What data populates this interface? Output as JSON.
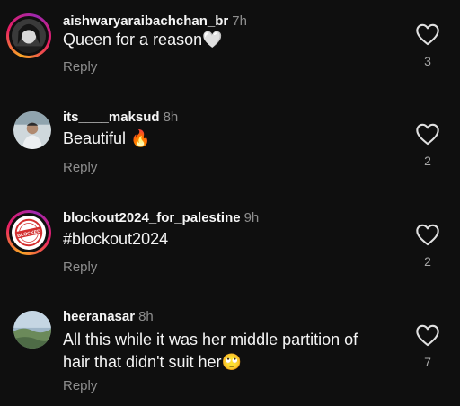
{
  "comments": [
    {
      "username": "aishwaryaraibachchan_br",
      "time": "7h",
      "text": "Queen for a reason",
      "emoji": "🤍",
      "reply": "Reply",
      "likes": "3",
      "avatar": "woman-black-white-photo",
      "story_ring": true
    },
    {
      "username": "its____maksud",
      "time": "8h",
      "text": "Beautiful ",
      "emoji": "🔥",
      "reply": "Reply",
      "likes": "2",
      "avatar": "man-portrait-photo",
      "story_ring": false
    },
    {
      "username": "blockout2024_for_palestine",
      "time": "9h",
      "text": "#blockout2024",
      "emoji": "",
      "reply": "Reply",
      "likes": "2",
      "avatar": "blocked-stamp",
      "avatar_text": "BLOCKED",
      "story_ring": true
    },
    {
      "username": "heeranasar",
      "time": "8h",
      "text_line1": "All this while it was her middle partition of",
      "text_line2": "hair that didn't suit her",
      "emoji": "🙄",
      "reply": "Reply",
      "likes": "7",
      "avatar": "landscape-photo",
      "story_ring": false
    }
  ],
  "colors": {
    "background": "#0f0f0f",
    "secondary_text": "#8e8e8e",
    "stamp_red": "#d32f2f"
  },
  "icons": {
    "like": "heart-outline-icon"
  }
}
